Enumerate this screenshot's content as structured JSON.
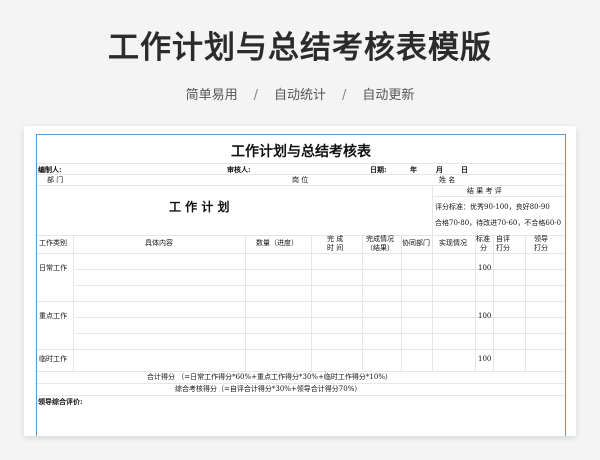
{
  "banner": {
    "title": "工作计划与总结考核表模版",
    "tags": [
      "简单易用",
      "自动统计",
      "自动更新"
    ],
    "separator": "/"
  },
  "form": {
    "title": "工作计划与总结考核表",
    "compiler_label": "编制人:",
    "reviewer_label": "审核人:",
    "date_label": "日期:",
    "year_label": "年",
    "month_label": "月",
    "day_label": "日",
    "department_label": "部 门",
    "position_label": "岗 位",
    "name_label": "姓 名",
    "result_eval_label": "结 果 考 评",
    "work_plan_title": "工 作 计 划",
    "criteria_line1": "评分标准：优秀90-100，良好80-90",
    "criteria_line2": "合格70-80，待改进70-60，不合格60-0",
    "headers": {
      "category": "工作类别",
      "content": "具体内容",
      "quantity": "数量（进度）",
      "finish_time_1": "完 成",
      "finish_time_2": "时 间",
      "completion_1": "完成情况",
      "completion_2": "（结果）",
      "coop_dept": "协同部门",
      "actual": "实现情况",
      "standard_1": "标准",
      "standard_2": "分",
      "self_1": "自评",
      "self_2": "打分",
      "leader_1": "领导",
      "leader_2": "打分"
    },
    "rows": [
      {
        "category": "日常工作",
        "score": "100"
      },
      {
        "category": "重点工作",
        "score": "100"
      },
      {
        "category": "临时工作",
        "score": "100"
      }
    ],
    "total_score": "合计得分 （=日常工作得分*60%+重点工作得分*30%+临时工作得分*10%）",
    "overall_score": "综合考核得分（=自评合计得分*30%+领导合计得分70%）",
    "leader_comment_label": "领导综合评价:"
  }
}
